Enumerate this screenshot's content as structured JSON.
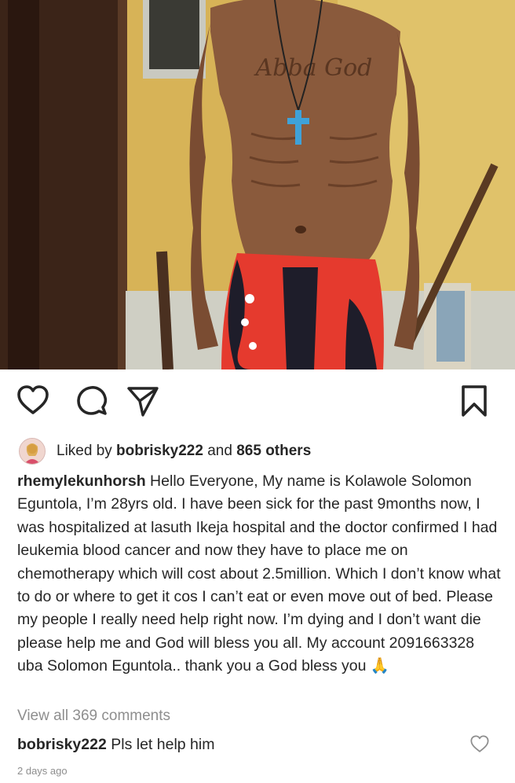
{
  "post": {
    "photo_tattoo_text": "Abba God",
    "actions": {
      "like_icon": "heart-outline-icon",
      "comment_icon": "comment-bubble-icon",
      "share_icon": "paper-plane-icon",
      "save_icon": "bookmark-icon"
    },
    "likes": {
      "prefix": "Liked by ",
      "user": "bobrisky222",
      "middle": " and ",
      "count": "865 others"
    },
    "caption": {
      "username": "rhemylekunhorsh",
      "text": " Hello Everyone, My name is Kolawole Solomon Eguntola, I’m 28yrs old. I have been sick for the past 9months now, I was hospitalized at lasuth Ikeja hospital and the doctor confirmed I had leukemia blood cancer and now they have to place me on chemotherapy which will cost about 2.5million.  Which I don’t know what to do or where to get it cos I can’t eat or even move out of bed. Please my people I really need help right now. I’m dying and I don’t want die please help me and God will bless you all. My account 2091663328 uba Solomon Eguntola.. thank you a God bless you ",
      "emoji": "🙏"
    },
    "view_comments": "View all 369 comments",
    "comment": {
      "username": "bobrisky222",
      "text": " Pls let help him"
    },
    "timestamp": "2 days ago"
  }
}
